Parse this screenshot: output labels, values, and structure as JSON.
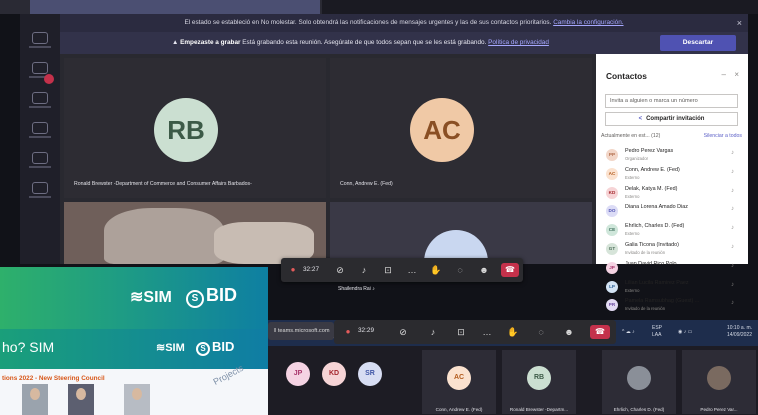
{
  "banner": {
    "dnd_text": "El estado se estableció en No molestar. Solo obtendrá las notificaciones de mensajes urgentes y las de sus contactos prioritarios.",
    "dnd_link": "Cambia la configuración.",
    "close": "×"
  },
  "recording": {
    "title": "Empezaste a grabar",
    "text": "Está grabando esta reunión. Asegúrate de que todos sepan que se les está grabando.",
    "link": "Política de privacidad",
    "dismiss": "Descartar"
  },
  "stage": {
    "tiles": [
      {
        "initials": "RB",
        "name": "Ronald Brewster -Department of Commerce and Consumer Affairs Barbados-"
      },
      {
        "initials": "AC",
        "name": "Conn, Andrew E. (Fed)"
      }
    ]
  },
  "controls": {
    "time": "32:27",
    "leave_icon": "☎",
    "presenter": "Shailendra Rai"
  },
  "panel": {
    "title": "Contactos",
    "invite_placeholder": "Invita a alguien o marca un número",
    "share_button": "Compartir invitación",
    "section": "Actualmente en est... (12)",
    "mute_all": "Silenciar a todos",
    "people": [
      {
        "initials": "PP",
        "name": "Pedro Perez Vargas",
        "role": "Organizador",
        "color": "#b06b4a",
        "bg": "#f2d6c8"
      },
      {
        "initials": "AC",
        "name": "Conn, Andrew E. (Fed)",
        "role": "Externo",
        "color": "#b35c1e",
        "bg": "#fbe2cf"
      },
      {
        "initials": "KD",
        "name": "Delak, Katya M. (Fed)",
        "role": "Externo",
        "color": "#a4262c",
        "bg": "#f6d4d6"
      },
      {
        "initials": "DO",
        "name": "Diana Lorena Amado Diaz",
        "role": "",
        "color": "#4f52b2",
        "bg": "#dcdcf6"
      },
      {
        "initials": "CE",
        "name": "Ehrlich, Charles D. (Fed)",
        "role": "Externo",
        "color": "#3c6e5a",
        "bg": "#cfe6da"
      },
      {
        "initials": "GT",
        "name": "Galia Ticona (Invitado)",
        "role": "Invitado de la reunión",
        "color": "#4a6b56",
        "bg": "#d6e4d9"
      },
      {
        "initials": "JP",
        "name": "Juan David Rico Polo",
        "role": "",
        "color": "#a8356c",
        "bg": "#f5d3e3"
      },
      {
        "initials": "LP",
        "name": "Lilian Lucila Ramirez Paez",
        "role": "Externo",
        "color": "#2c5f93",
        "bg": "#d3e3f4"
      },
      {
        "initials": "PR",
        "name": "Pamela Ramsubhag (Guest) ...",
        "role": "Invitado de la reunión",
        "color": "#6b4aa0",
        "bg": "#e3dbf3"
      }
    ]
  },
  "subbar": {
    "url": "teams.microsoft.com",
    "time": "32:29"
  },
  "taskbar": {
    "lang": "ESP",
    "region": "LAA",
    "time": "10:10 a. m.",
    "date": "14/09/2022"
  },
  "thumbs": {
    "circles": [
      {
        "initials": "JP",
        "color": "#a8356c",
        "bg": "#f5d3e3"
      },
      {
        "initials": "KD",
        "color": "#a4262c",
        "bg": "#f6d4d6"
      },
      {
        "initials": "SR",
        "color": "#3f56a6",
        "bg": "#d7ddf3"
      }
    ],
    "tiles": [
      {
        "initials": "AC",
        "name": "Conn, Andrew E. (Fed)",
        "color": "#b35c1e",
        "bg": "#fbe2cf"
      },
      {
        "initials": "RB",
        "name": "Ronald Brewster -Departm...",
        "color": "#3c5a47",
        "bg": "#cbdfd1"
      },
      {
        "initials": "",
        "name": "Ehrlich, Charles D. (Fed)",
        "color": "#ffffff",
        "bg": "#8a8f98"
      },
      {
        "initials": "",
        "name": "Pedro Perez Var...",
        "color": "#ffffff",
        "bg": "#7a6a60"
      }
    ]
  },
  "slides": {
    "sim": "SIM",
    "bid": "BID",
    "who": "ho?  SIM",
    "council": "tions 2022 - New Steering Council",
    "projects": "Projects"
  }
}
